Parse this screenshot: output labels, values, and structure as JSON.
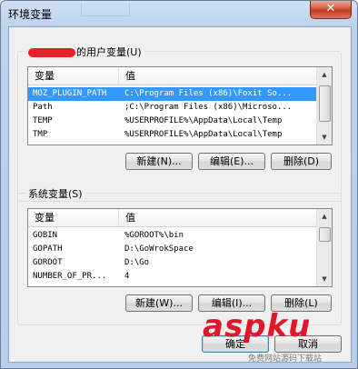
{
  "window": {
    "title": "环境变量",
    "close_glyph": "✕"
  },
  "user_group": {
    "title": "的用户变量(U)",
    "columns": [
      "变量",
      "值"
    ],
    "rows": [
      {
        "name": "MOZ_PLUGIN_PATH",
        "value": "C:\\Program Files (x86)\\Foxit So...",
        "selected": true
      },
      {
        "name": "Path",
        "value": ";C:\\Program Files (x86)\\Microso..."
      },
      {
        "name": "TEMP",
        "value": "%USERPROFILE%\\AppData\\Local\\Temp"
      },
      {
        "name": "TMP",
        "value": "%USERPROFILE%\\AppData\\Local\\Temp"
      }
    ],
    "buttons": {
      "new": "新建(N)...",
      "edit": "编辑(E)...",
      "delete": "删除(D)"
    }
  },
  "system_group": {
    "title": "系统变量(S)",
    "columns": [
      "变量",
      "值"
    ],
    "rows": [
      {
        "name": "GOBIN",
        "value": "%GOROOT%\\bin"
      },
      {
        "name": "GOPATH",
        "value": "D:\\GoWrokSpace"
      },
      {
        "name": "GOROOT",
        "value": "D:\\Go"
      },
      {
        "name": "NUMBER_OF_PR...",
        "value": "4"
      }
    ],
    "buttons": {
      "new": "新建(W)...",
      "edit": "编辑(I)...",
      "delete": "删除(L)"
    }
  },
  "footer": {
    "ok": "确定",
    "cancel": "取消"
  },
  "watermark": {
    "brand": "aspku",
    "tagline": "免费网站源码下载站"
  },
  "icons": {
    "scroll_up": "up-arrow-icon",
    "scroll_down": "down-arrow-icon",
    "close": "close-icon"
  }
}
